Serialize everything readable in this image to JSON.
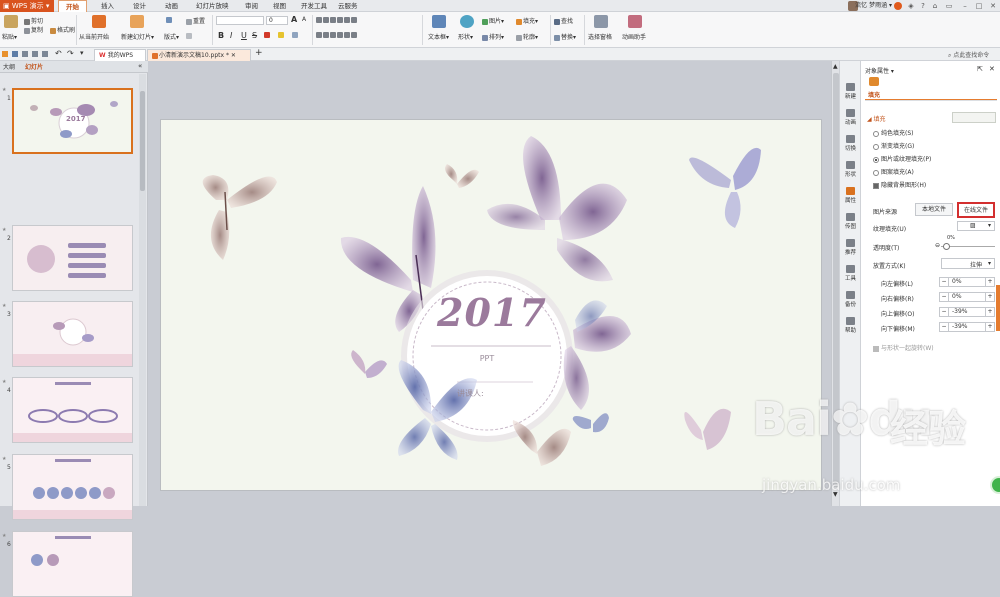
{
  "menubar": {
    "app_name": "WPS 演示",
    "tabs": [
      "开始",
      "插入",
      "设计",
      "动画",
      "幻灯片放映",
      "审阅",
      "视图",
      "开发工具",
      "云服务"
    ],
    "active_tab": "开始",
    "user": "流忆 梦雨涵"
  },
  "ribbon": {
    "paste": "粘贴",
    "cut": "剪切",
    "copy": "复制",
    "format_painter": "格式刷",
    "from_current": "从当前开始",
    "new_slide": "新建幻灯片",
    "layout": "版式",
    "reset": "重置",
    "font_size": "0",
    "text_box": "文本框",
    "shape": "形状",
    "picture": "图片",
    "fill": "填充",
    "arrange": "排列",
    "outline": "轮廓",
    "find": "查找",
    "replace": "替换",
    "select_pane": "选择窗格",
    "assistant": "动画助手",
    "bold": "B",
    "italic": "I",
    "underline": "U",
    "strike": "S",
    "grow": "A",
    "shrink": "A"
  },
  "doc_tabs": {
    "home": "我的WPS",
    "file": "小清新演示文稿10.pptx *",
    "search_placeholder": "点此查找命令"
  },
  "left_pane": {
    "tab_outline": "大纲",
    "tab_slides": "幻灯片",
    "slides": [
      "1",
      "2",
      "3",
      "4",
      "5",
      "6"
    ]
  },
  "slide": {
    "year": "2017",
    "subtitle": "PPT",
    "presenter": "讲课人:"
  },
  "props": {
    "title": "对象属性",
    "tab": "填充",
    "section": "填充",
    "options": [
      "纯色填充(S)",
      "渐变填充(G)",
      "图片或纹理填充(P)",
      "图案填充(A)"
    ],
    "selected_option_index": 2,
    "hide_bg": "隐藏背景图形(H)",
    "pic_source": "图片来源",
    "local_file": "本地文件",
    "online_file": "在线文件",
    "texture": "纹理填充(U)",
    "transparency": "透明度(T)",
    "transparency_value": "0%",
    "placement": "放置方式(K)",
    "placement_value": "拉伸",
    "offset_left": "向左偏移(L)",
    "offset_left_value": "0%",
    "offset_right": "向右偏移(R)",
    "offset_right_value": "0%",
    "offset_up": "向上偏移(O)",
    "offset_up_value": "-39%",
    "offset_down": "向下偏移(M)",
    "offset_down_value": "-39%",
    "rotate_with_shape": "与形状一起旋转(W)"
  },
  "icon_strip": [
    "新建",
    "动画",
    "切换",
    "形状",
    "属性",
    "传图",
    "推荐",
    "工具",
    "备份",
    "帮助"
  ],
  "watermark": {
    "logo": "Bai",
    "logo2": "du",
    "cn": "经验",
    "url": "jingyan.baidu.com"
  },
  "colors": {
    "accent": "#d9531e",
    "highlight_box": "#d32f2f",
    "title_purple": "#9b7a9c"
  }
}
